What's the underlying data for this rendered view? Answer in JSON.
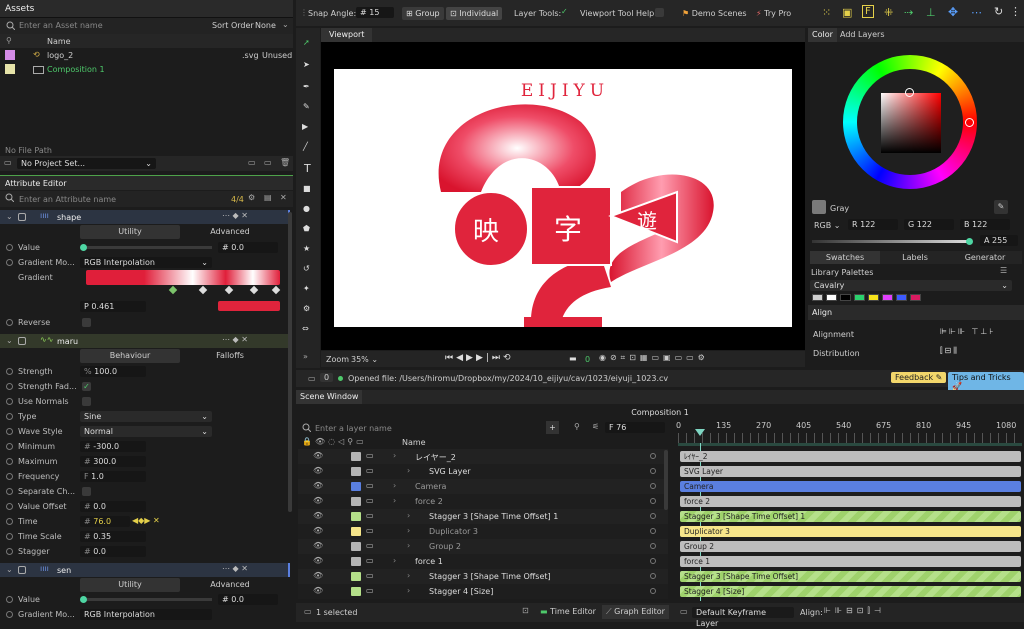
{
  "assets": {
    "title": "Assets",
    "search_placeholder": "Enter an Asset name",
    "sort_label": "Sort Order",
    "sort_value": "None",
    "col_name": "Name",
    "items": [
      {
        "name": "logo_2",
        "ext": ".svg",
        "status": "Unused"
      },
      {
        "name": "Composition 1"
      }
    ],
    "file_path_label": "No File Path",
    "project_set": "No Project Set..."
  },
  "attr": {
    "title": "Attribute Editor",
    "search_placeholder": "Enter an Attribute name",
    "count": "4/4",
    "shape": {
      "name": "shape",
      "tab_utility": "Utility",
      "tab_advanced": "Advanced",
      "value_label": "Value",
      "value": "0.0",
      "gm_label": "Gradient Mo...",
      "gm_value": "RGB Interpolation",
      "gradient_label": "Gradient",
      "pos": "0.461",
      "reverse_label": "Reverse"
    },
    "maru": {
      "name": "maru",
      "tab_behaviour": "Behaviour",
      "tab_falloffs": "Falloffs",
      "rows": [
        {
          "label": "Strength",
          "prefix": "%",
          "value": "100.0"
        },
        {
          "label": "Strength Fad...",
          "check": true
        },
        {
          "label": "Use Normals",
          "check": false
        },
        {
          "label": "Type",
          "select": "Sine"
        },
        {
          "label": "Wave Style",
          "select": "Normal"
        },
        {
          "label": "Minimum",
          "prefix": "#",
          "value": "-300.0"
        },
        {
          "label": "Maximum",
          "prefix": "#",
          "value": "300.0"
        },
        {
          "label": "Frequency",
          "prefix": "F",
          "value": "1.0"
        },
        {
          "label": "Separate Ch...",
          "check": false
        },
        {
          "label": "Value Offset",
          "prefix": "#",
          "value": "0.0"
        },
        {
          "label": "Time",
          "prefix": "#",
          "value": "76.0"
        },
        {
          "label": "Time Scale",
          "prefix": "#",
          "value": "0.35"
        },
        {
          "label": "Stagger",
          "prefix": "#",
          "value": "0.0"
        }
      ]
    },
    "sen": {
      "name": "sen",
      "tab_utility": "Utility",
      "tab_advanced": "Advanced",
      "value_label": "Value",
      "value": "0.0",
      "gm_label": "Gradient Mo...",
      "gm_value": "RGB Interpolation"
    }
  },
  "toolbar": {
    "snap_angle_label": "Snap Angle:",
    "snap_angle_value": "15",
    "group": "Group",
    "individual": "Individual",
    "layer_tools": "Layer Tools:",
    "viewport_help": "Viewport Tool Help:",
    "demo_scenes": "Demo Scenes",
    "try_pro": "Try Pro"
  },
  "viewport": {
    "tab": "Viewport",
    "zoom_label": "Zoom",
    "zoom_value": "35%",
    "frame": "0",
    "logo_title": "EIJIYU",
    "glyph1": "映",
    "glyph2": "字",
    "glyph3": "遊"
  },
  "color": {
    "tab_color": "Color",
    "tab_add_layers": "Add Layers",
    "swatch_name": "Gray",
    "mode": "RGB",
    "r": "122",
    "g": "122",
    "b": "122",
    "a": "255",
    "tab_swatches": "Swatches",
    "tab_labels": "Labels",
    "tab_generator": "Generator",
    "library_label": "Library Palettes",
    "palette": "Cavalry",
    "palette_colors": [
      "#cfcfcf",
      "#ffffff",
      "#000000",
      "#2bd16d",
      "#f5e21b",
      "#e040fb",
      "#3d5afe",
      "#d81b60"
    ]
  },
  "align": {
    "title": "Align",
    "alignment_label": "Alignment",
    "distribution_label": "Distribution"
  },
  "status": {
    "badge": "0",
    "message": "Opened file: /Users/hiromu/Dropbox/my/2024/10_eijiyu/cav/1023/eiyuji_1023.cv",
    "feedback": "Feedback",
    "tips": "Tips and Tricks"
  },
  "scene": {
    "title": "Scene Window",
    "comp_title": "Composition 1",
    "layer_search_placeholder": "Enter a layer name",
    "frame_prefix": "F",
    "frame": "76",
    "col_name": "Name",
    "ruler": [
      "0",
      "135",
      "270",
      "405",
      "540",
      "675",
      "810",
      "945",
      "1080"
    ],
    "layers": [
      {
        "name": "レイヤー_2",
        "color": "#b5b5b5",
        "indent": 0,
        "track": "ﾚｲﾔｰ_2",
        "track_color": "#bdbdbd"
      },
      {
        "name": "SVG Layer",
        "color": "#b5b5b5",
        "indent": 1,
        "track": "SVG Layer",
        "track_color": "#bdbdbd"
      },
      {
        "name": "Camera",
        "color": "#5a7fe0",
        "indent": 0,
        "track": "Camera",
        "track_color": "#5a7fe0",
        "dim": true
      },
      {
        "name": "force 2",
        "color": "#b5b5b5",
        "indent": 0,
        "track": "force 2",
        "track_color": "#bdbdbd",
        "dim": true
      },
      {
        "name": "Stagger 3 [Shape Time Offset] 1",
        "color": "#b5e08a",
        "indent": 1,
        "track": "Stagger 3 [Shape Time Offset] 1",
        "stripe": true
      },
      {
        "name": "Duplicator 3",
        "color": "#f6e58a",
        "indent": 1,
        "track": "Duplicator 3",
        "track_color": "#f6e58a",
        "dim": true
      },
      {
        "name": "Group 2",
        "color": "#b5b5b5",
        "indent": 1,
        "track": "Group 2",
        "track_color": "#bdbdbd",
        "dim": true
      },
      {
        "name": "force 1",
        "color": "#b5b5b5",
        "indent": 0,
        "track": "force 1",
        "track_color": "#bdbdbd"
      },
      {
        "name": "Stagger 3 [Shape Time Offset]",
        "color": "#b5e08a",
        "indent": 1,
        "track": "Stagger 3 [Shape Time Offset]",
        "stripe": true
      },
      {
        "name": "Stagger 4 [Size]",
        "color": "#b5e08a",
        "indent": 1,
        "track": "Stagger 4 [Size]",
        "stripe": true
      }
    ]
  },
  "bottom": {
    "selected": "1 selected",
    "time_editor": "Time Editor",
    "graph_editor": "Graph Editor",
    "keyframe_layer": "Default Keyframe Layer",
    "align_label": "Align:"
  }
}
